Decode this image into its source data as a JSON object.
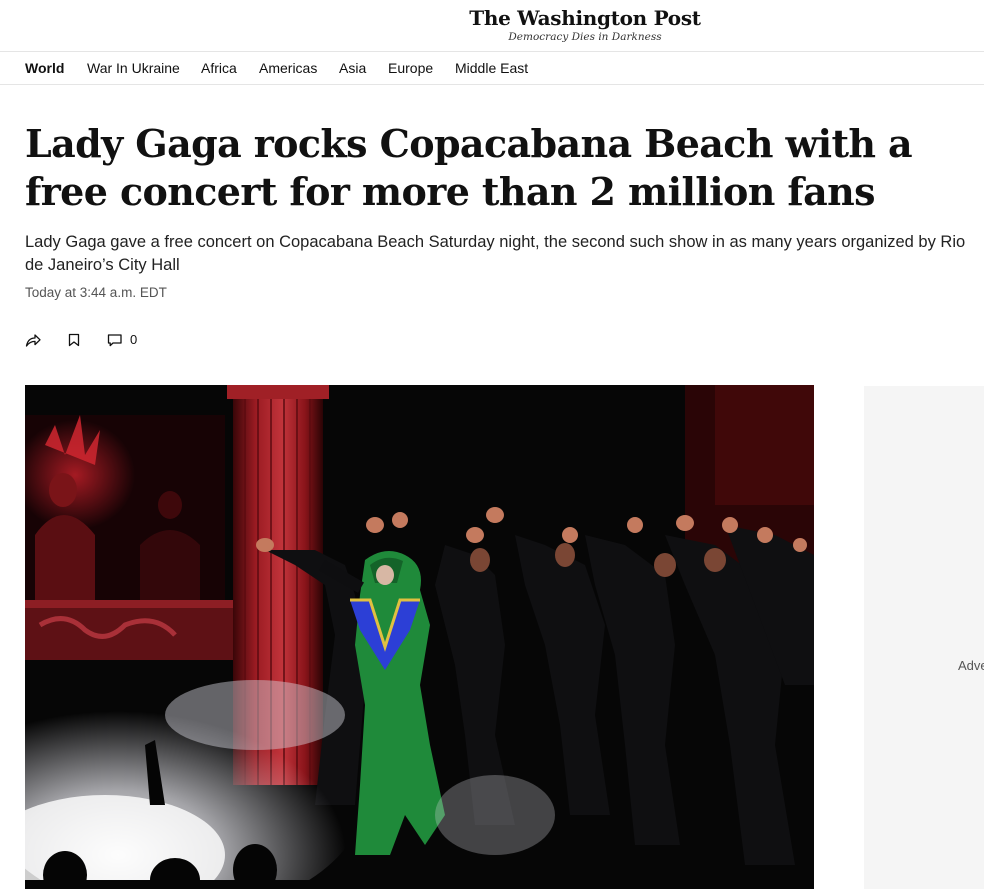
{
  "masthead": {
    "logo_title": "The Washington Post",
    "logo_tagline": "Democracy Dies in Darkness"
  },
  "subnav": {
    "items": [
      {
        "label": "World",
        "active": true
      },
      {
        "label": "War In Ukraine",
        "active": false
      },
      {
        "label": "Africa",
        "active": false
      },
      {
        "label": "Americas",
        "active": false
      },
      {
        "label": "Asia",
        "active": false
      },
      {
        "label": "Europe",
        "active": false
      },
      {
        "label": "Middle East",
        "active": false
      }
    ]
  },
  "article": {
    "headline": "Lady Gaga rocks Copacabana Beach with a free concert for more than 2 million fans",
    "dek": "Lady Gaga gave a free concert on Copacabana Beach Saturday night, the second such show in as many years organized by Rio de Janeiro’s City Hall",
    "timestamp": "Today at 3:44 a.m. EDT",
    "actions": {
      "share_icon": "share-arrow-icon",
      "save_icon": "bookmark-icon",
      "comment_icon": "comment-bubble-icon",
      "comment_count": "0"
    }
  },
  "ad": {
    "label": "Adve"
  },
  "colors": {
    "text": "#111111",
    "subtle_text": "#555555",
    "divider": "#e5e5e5",
    "ad_background": "#f5f5f5",
    "stage_red": "#8e1a1f",
    "dress_green": "#1f8a3a",
    "sequin_blue": "#2c3fd6"
  }
}
